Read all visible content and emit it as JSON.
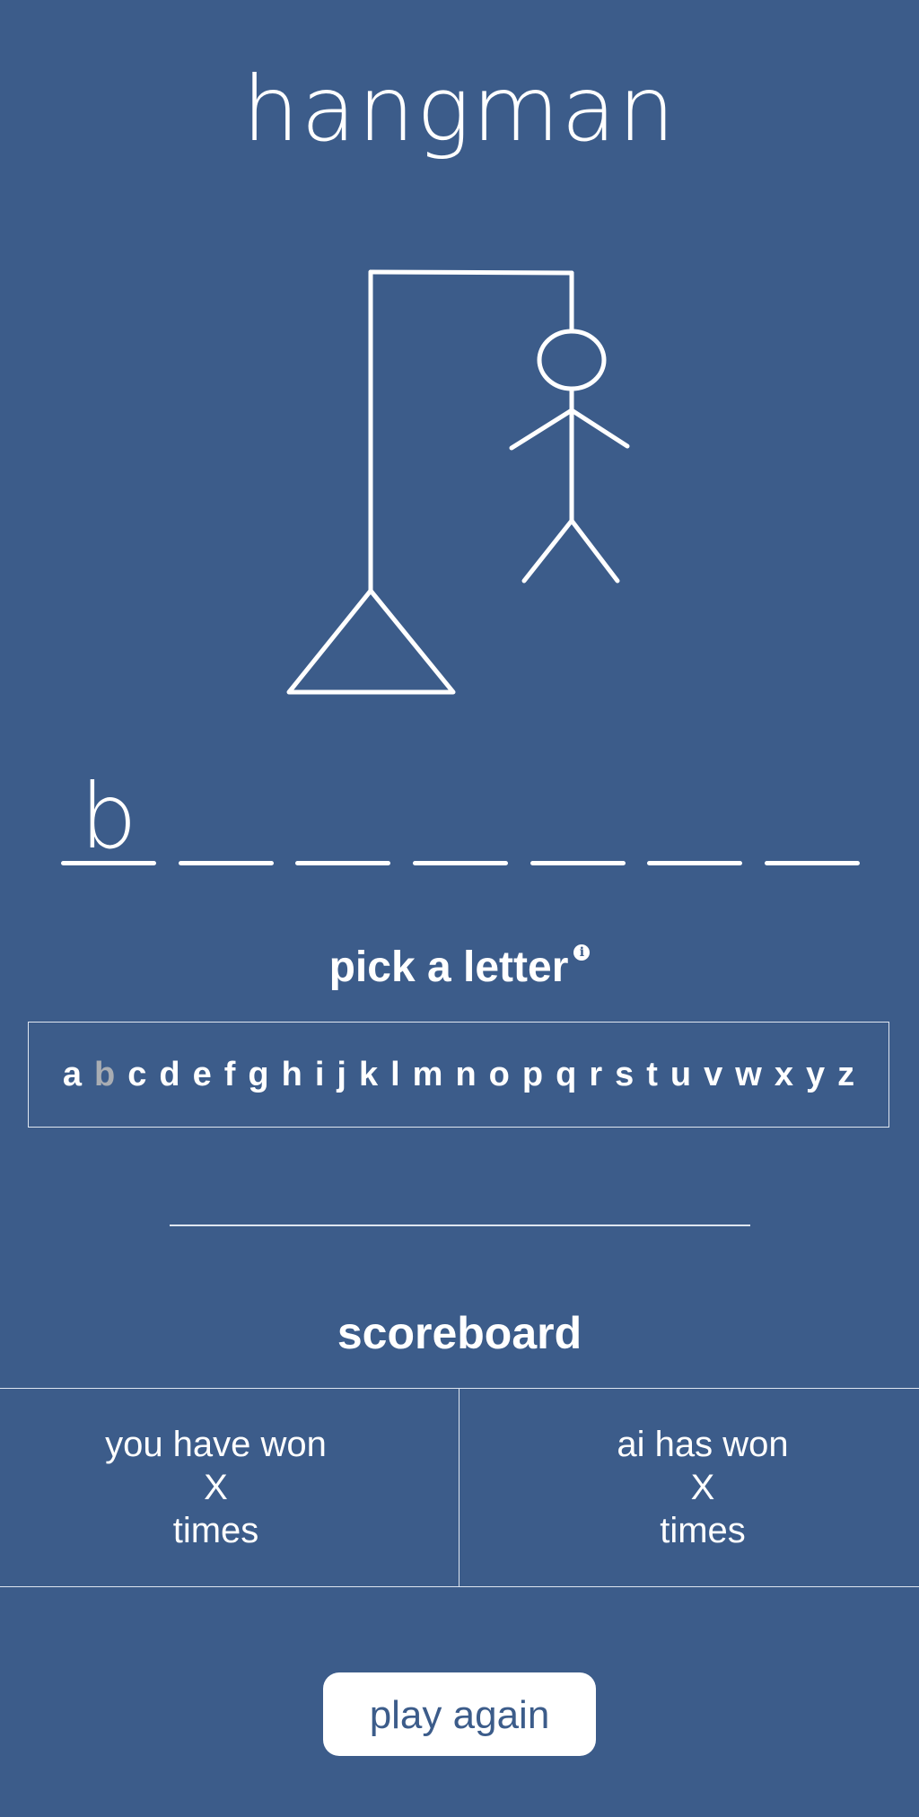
{
  "title": "hangman",
  "word": {
    "slots": [
      "b",
      "",
      "",
      "",
      "",
      "",
      ""
    ]
  },
  "picker": {
    "label": "pick a letter",
    "info_icon": "info-icon",
    "letters": [
      "a",
      "b",
      "c",
      "d",
      "e",
      "f",
      "g",
      "h",
      "i",
      "j",
      "k",
      "l",
      "m",
      "n",
      "o",
      "p",
      "q",
      "r",
      "s",
      "t",
      "u",
      "v",
      "w",
      "x",
      "y",
      "z"
    ],
    "used": [
      "b"
    ],
    "used_color": "#a9adb3"
  },
  "scoreboard": {
    "title": "scoreboard",
    "player": {
      "line1": "you have won",
      "count": "X",
      "line3": "times"
    },
    "ai": {
      "line1": "ai has won",
      "count": "X",
      "line3": "times"
    }
  },
  "actions": {
    "play_again_label": "play again"
  },
  "colors": {
    "background": "#3c5c8a",
    "foreground": "#ffffff"
  }
}
